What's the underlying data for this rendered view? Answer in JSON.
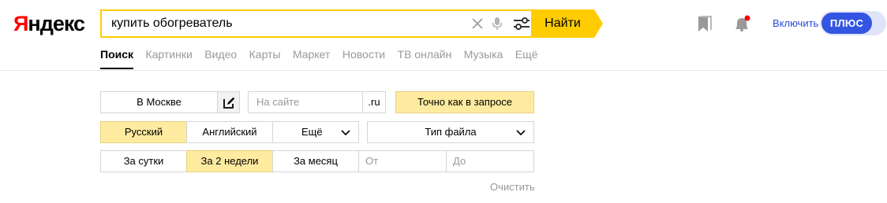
{
  "header": {
    "logo_first": "Я",
    "logo_rest": "ндекс",
    "search_query": "купить обогреватель",
    "search_button": "Найти",
    "enable_link": "Включить",
    "plus_label": "ПЛЮС"
  },
  "tabs": [
    "Поиск",
    "Картинки",
    "Видео",
    "Карты",
    "Маркет",
    "Новости",
    "ТВ онлайн",
    "Музыка",
    "Ещё"
  ],
  "active_tab": "Поиск",
  "filters": {
    "region_label": "В Москве",
    "site_placeholder": "На сайте",
    "domain_label": ".ru",
    "exact_label": "Точно как в запросе",
    "lang_russian": "Русский",
    "lang_english": "Английский",
    "lang_more": "Ещё",
    "file_type": "Тип файла",
    "period_day": "За сутки",
    "period_2weeks": "За 2 недели",
    "period_month": "За месяц",
    "date_from_placeholder": "От",
    "date_to_placeholder": "До",
    "clear_label": "Очистить"
  },
  "colors": {
    "accent_yellow": "#ffcc00",
    "selected_fill": "#ffeba0",
    "plus_blue": "#3454e2",
    "link_blue": "#2b4ad8",
    "logo_red": "#ff0000"
  },
  "icons": [
    "clear-icon",
    "microphone-icon",
    "filter-settings-icon",
    "bookmark-icon",
    "bell-icon",
    "edit-icon",
    "chevron-down-icon"
  ]
}
